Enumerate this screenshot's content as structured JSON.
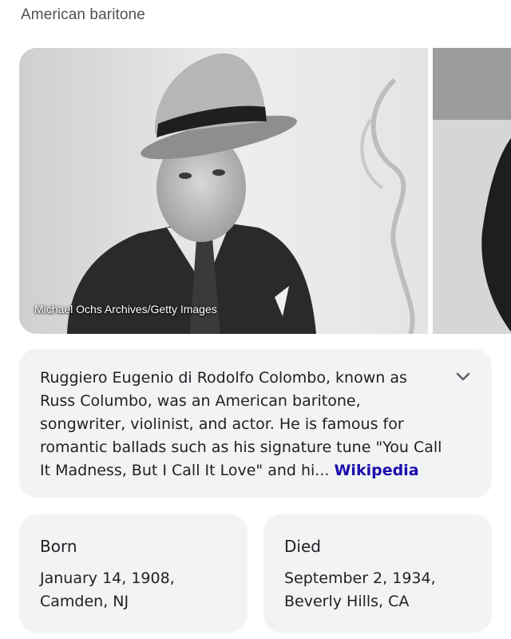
{
  "header": {
    "subtitle": "American baritone"
  },
  "gallery": {
    "main_photo": {
      "icon": "person-photo-icon",
      "credit": "Michael Ochs Archives/Getty Images"
    },
    "next_photo": {
      "icon": "person-photo-icon"
    }
  },
  "description": {
    "text": "Ruggiero Eugenio di Rodolfo Colombo, known as Russ Columbo, was an American baritone, songwriter, violinist, and actor. He is famous for romantic ballads such as his signature tune \"You Call It Madness, But I Call It Love\" and hi... ",
    "source_link": "Wikipedia",
    "expand_icon": "chevron-down-icon",
    "link_color": "#1a0dab"
  },
  "facts": [
    {
      "label": "Born",
      "value": "January 14, 1908, Camden, NJ"
    },
    {
      "label": "Died",
      "value": "September 2, 1934, Beverly Hills, CA"
    }
  ],
  "colors": {
    "card_background": "#f1f3f4",
    "text": "#202124",
    "subtitle": "#4d5156"
  }
}
